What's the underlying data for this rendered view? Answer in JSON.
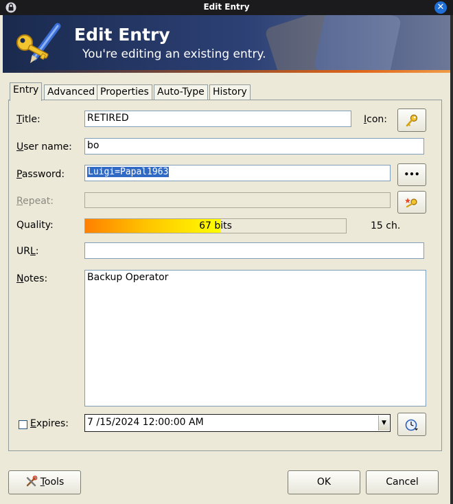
{
  "window": {
    "title": "Edit Entry"
  },
  "banner": {
    "title": "Edit Entry",
    "subtitle": "You're editing an existing entry."
  },
  "tabs": [
    "Entry",
    "Advanced",
    "Properties",
    "Auto-Type",
    "History"
  ],
  "form": {
    "title_label": "itle:",
    "title_label_ul": "T",
    "title_value": "RETIRED",
    "icon_label": "con:",
    "icon_label_ul": "I",
    "username_label": "ser name:",
    "username_label_ul": "U",
    "username_value": "bo",
    "password_label": "assword:",
    "password_label_ul": "P",
    "password_value": "Luigi=Papal1963",
    "repeat_label": "epeat:",
    "repeat_label_ul": "R",
    "repeat_value": "",
    "quality_label": "Quality:",
    "quality_text": "67 bits",
    "quality_fraction": 0.52,
    "char_count": "15 ch.",
    "url_label_pre": "UR",
    "url_label_ul": "L",
    "url_label_post": ":",
    "url_value": "",
    "notes_label_ul": "N",
    "notes_label": "otes:",
    "notes_value": "Backup Operator",
    "expires_label_ul": "E",
    "expires_label": "xpires:",
    "expires_checked": false,
    "expires_value": "7 /15/2024 12:00:00 AM"
  },
  "buttons": {
    "generate": "•••",
    "tools_ul": "T",
    "tools": "ools",
    "ok": "OK",
    "cancel": "Cancel"
  },
  "icons": {
    "window": "lock-icon",
    "close": "close-icon",
    "logo": "key-pen-icon",
    "entry_icon": "key-icon",
    "repeat": "key-wand-icon",
    "expires": "clock-icon",
    "tools": "tools-icon"
  },
  "colors": {
    "titlebar": "#1b1b1e",
    "banner": "#2d4176",
    "selection": "#316ac5",
    "dialog": "#ece9d8"
  }
}
